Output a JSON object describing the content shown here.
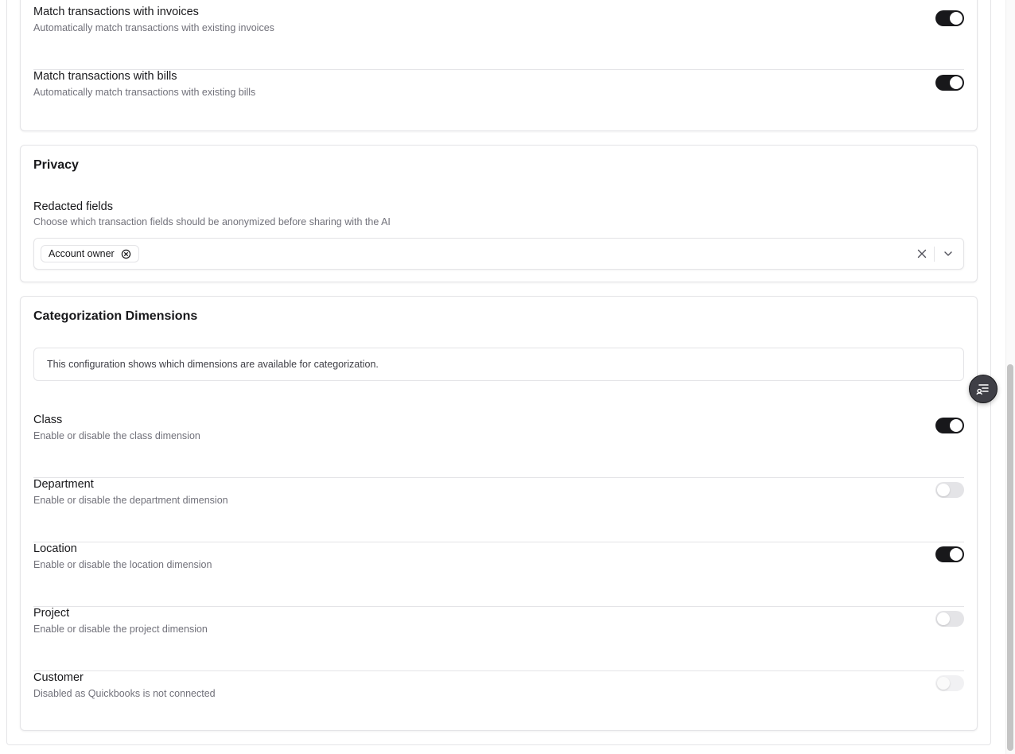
{
  "matching": {
    "rows": [
      {
        "title": "Match transactions with invoices",
        "description": "Automatically match transactions with existing invoices",
        "enabled": true
      },
      {
        "title": "Match transactions with bills",
        "description": "Automatically match transactions with existing bills",
        "enabled": true
      }
    ]
  },
  "privacy": {
    "title": "Privacy",
    "redacted_label": "Redacted fields",
    "redacted_description": "Choose which transaction fields should be anonymized before sharing with the AI",
    "selected_chips": [
      "Account owner"
    ],
    "icons": {
      "chip_remove": "circle-x-icon",
      "clear": "x-icon",
      "dropdown": "chevron-down-icon"
    }
  },
  "dimensions": {
    "title": "Categorization Dimensions",
    "info": "This configuration shows which dimensions are available for categorization.",
    "rows": [
      {
        "title": "Class",
        "description": "Enable or disable the class dimension",
        "state": "on"
      },
      {
        "title": "Department",
        "description": "Enable or disable the department dimension",
        "state": "off"
      },
      {
        "title": "Location",
        "description": "Enable or disable the location dimension",
        "state": "on"
      },
      {
        "title": "Project",
        "description": "Enable or disable the project dimension",
        "state": "off"
      },
      {
        "title": "Customer",
        "description": "Disabled as Quickbooks is not connected",
        "state": "disabled"
      }
    ]
  },
  "floating_button": {
    "icon": "list-settings-icon"
  },
  "colors": {
    "toggle_on": "#18181b",
    "toggle_off": "#e4e4e7",
    "border": "#e4e4e7",
    "muted_text": "#71717a"
  }
}
